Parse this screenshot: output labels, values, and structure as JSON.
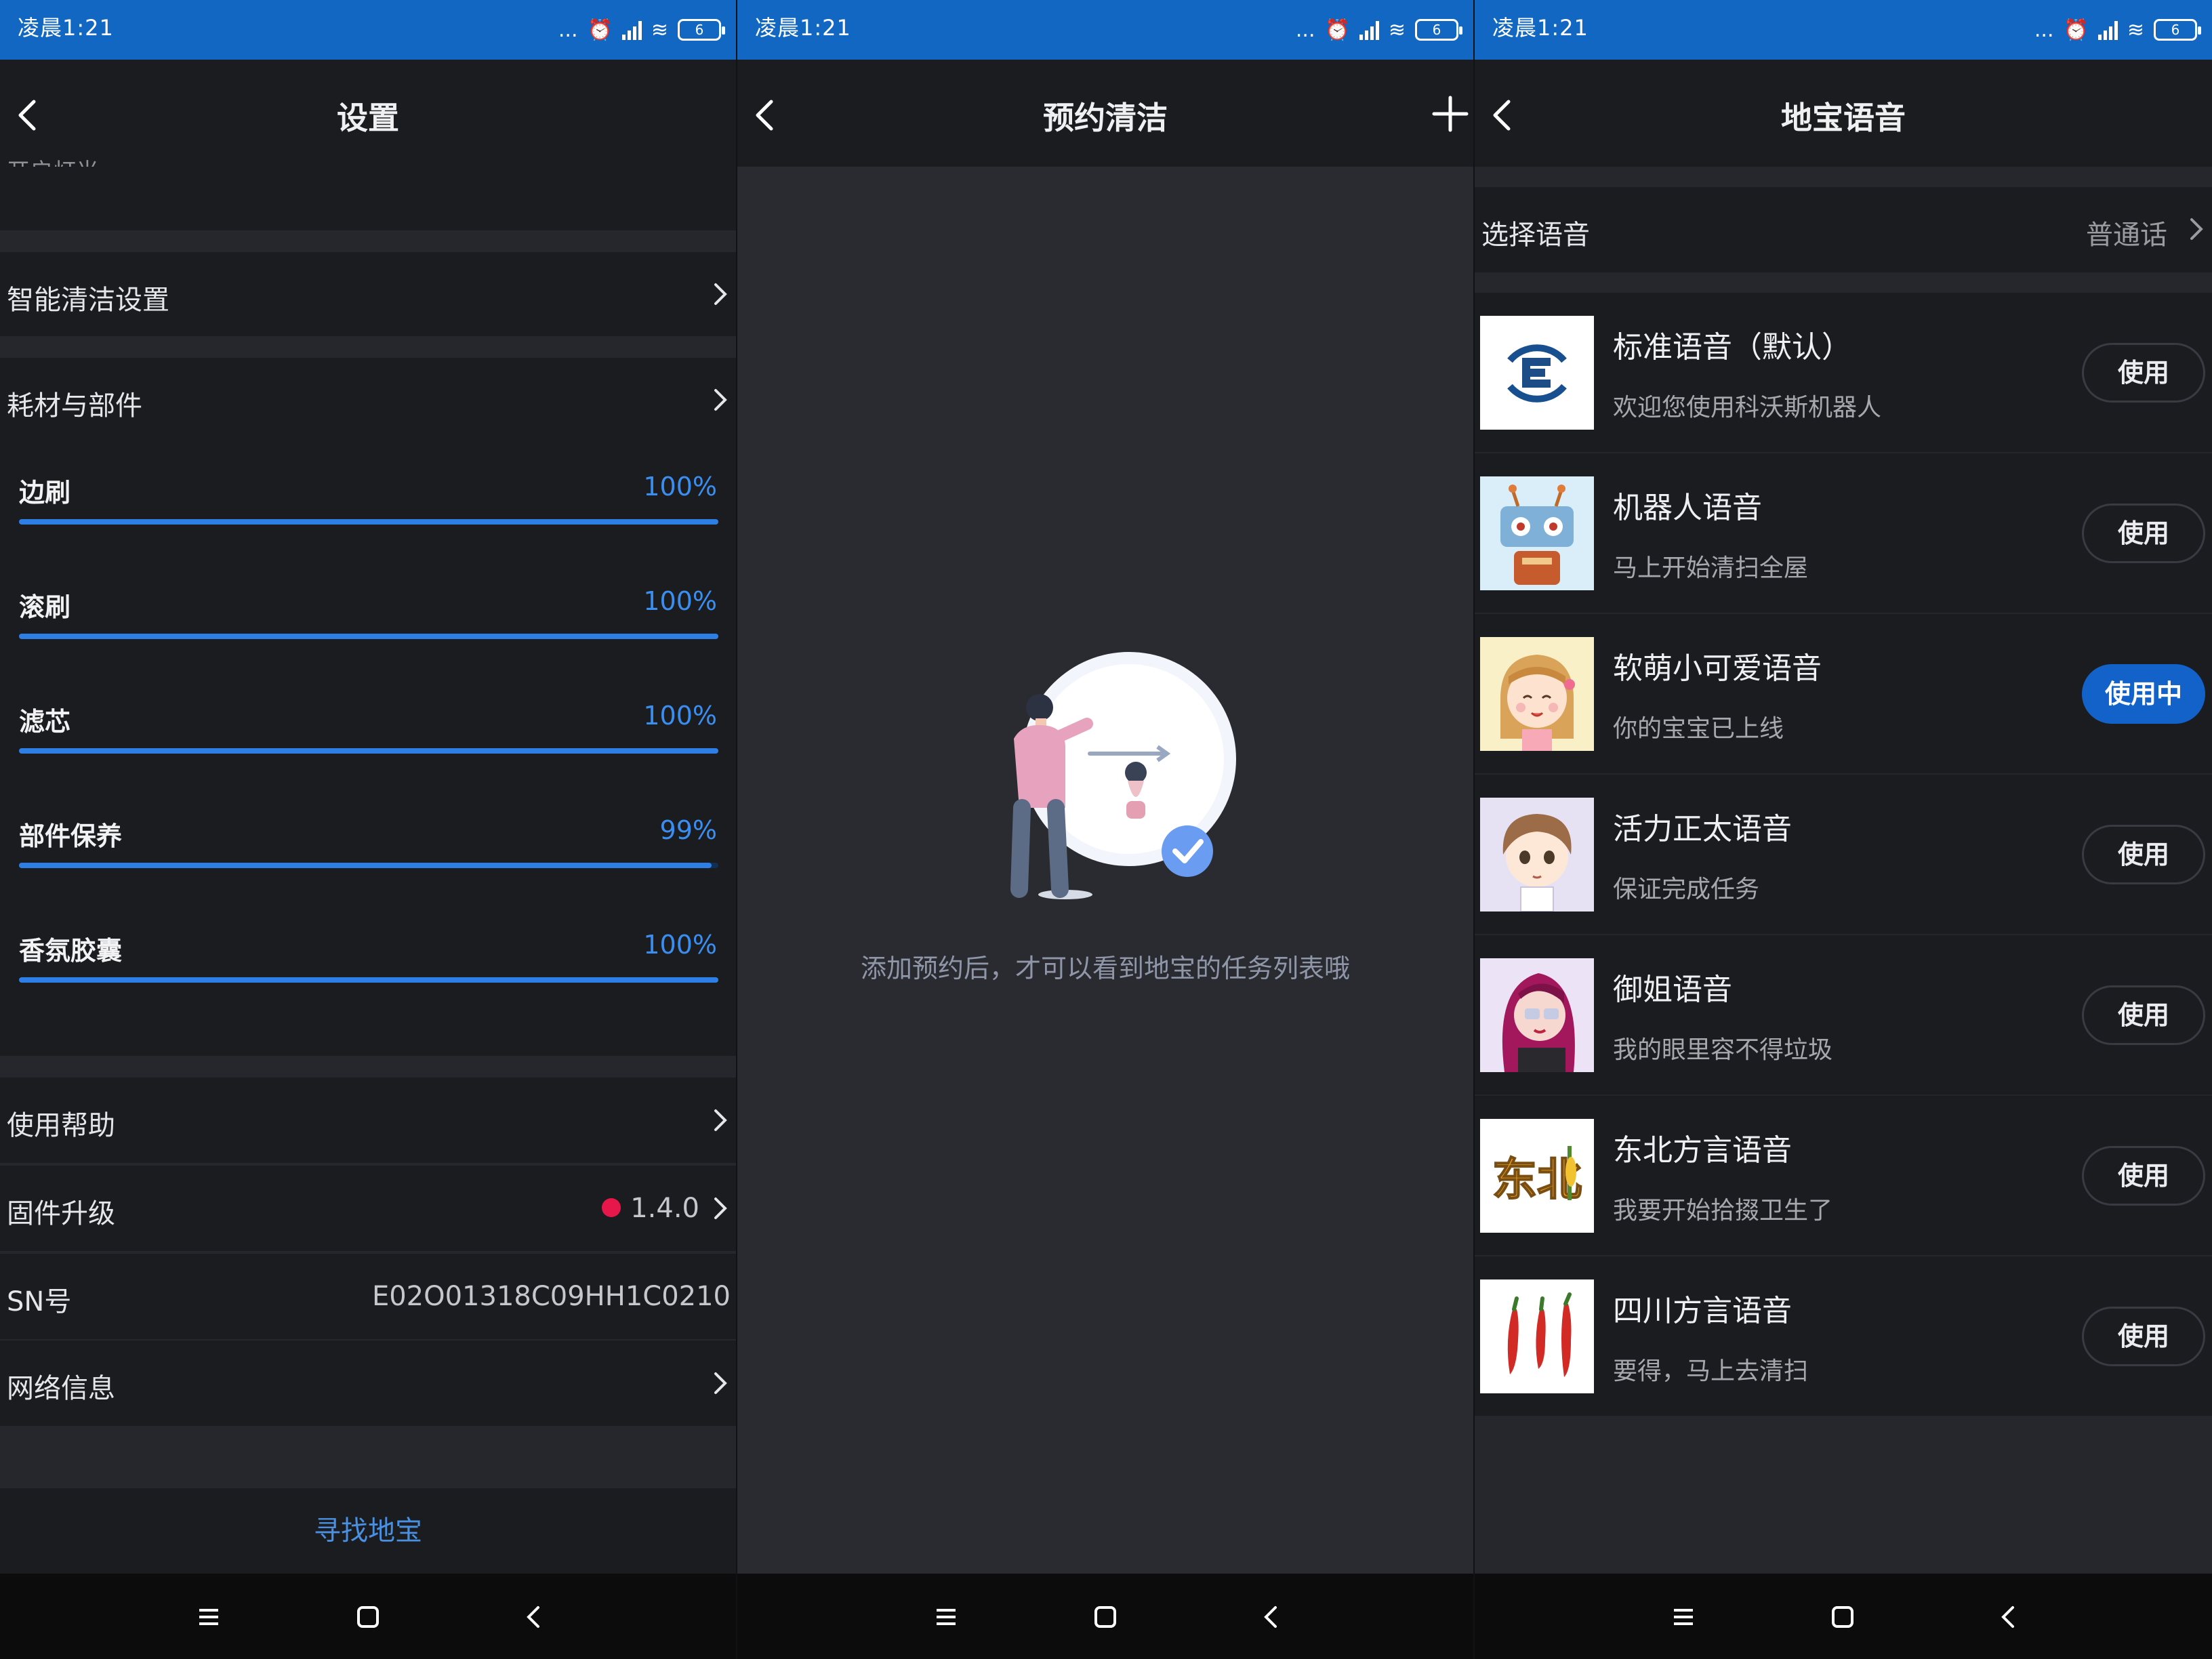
{
  "status": {
    "time": "凌晨1:21",
    "dots": "...",
    "battery": "6"
  },
  "settings": {
    "title": "设置",
    "cut_label": "开启灯光",
    "smart_clean": "智能清洁设置",
    "consumables": "耗材与部件",
    "items": [
      {
        "name": "边刷",
        "pct": "100%",
        "level": 100
      },
      {
        "name": "滚刷",
        "pct": "100%",
        "level": 100
      },
      {
        "name": "滤芯",
        "pct": "100%",
        "level": 100
      },
      {
        "name": "部件保养",
        "pct": "99%",
        "level": 99
      },
      {
        "name": "香氛胶囊",
        "pct": "100%",
        "level": 100
      }
    ],
    "help": "使用帮助",
    "firmware_label": "固件升级",
    "firmware_version": "1.4.0",
    "sn_label": "SN号",
    "sn_value": "E02O01318C09HH1C0210",
    "network": "网络信息",
    "find": "寻找地宝"
  },
  "schedule": {
    "title": "预约清洁",
    "empty_message": "添加预约后，才可以看到地宝的任务列表哦"
  },
  "voice": {
    "title": "地宝语音",
    "select_label": "选择语音",
    "select_value": "普通话",
    "items": [
      {
        "name": "标准语音（默认）",
        "desc": "欢迎您使用科沃斯机器人",
        "button": "使用",
        "active": false,
        "avatar": "ecovacs-logo"
      },
      {
        "name": "机器人语音",
        "desc": "马上开始清扫全屋",
        "button": "使用",
        "active": false,
        "avatar": "robot"
      },
      {
        "name": "软萌小可爱语音",
        "desc": "你的宝宝已上线",
        "button": "使用中",
        "active": true,
        "avatar": "cute-girl"
      },
      {
        "name": "活力正太语音",
        "desc": "保证完成任务",
        "button": "使用",
        "active": false,
        "avatar": "boy"
      },
      {
        "name": "御姐语音",
        "desc": "我的眼里容不得垃圾",
        "button": "使用",
        "active": false,
        "avatar": "lady"
      },
      {
        "name": "东北方言语音",
        "desc": "我要开始拾掇卫生了",
        "button": "使用",
        "active": false,
        "avatar": "dongbei",
        "avatar_text": "东北"
      },
      {
        "name": "四川方言语音",
        "desc": "要得，马上去清扫",
        "button": "使用",
        "active": false,
        "avatar": "chili-peppers"
      }
    ]
  },
  "colors": {
    "accent": "#2d7fe6",
    "statusbar": "#1267c2",
    "active_button": "#1262c9",
    "firmware_dot": "#e8174b"
  }
}
